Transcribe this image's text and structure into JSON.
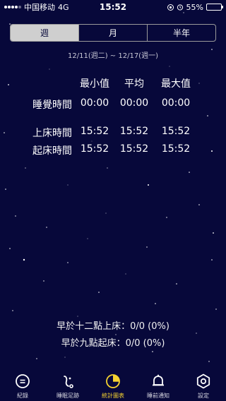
{
  "status_bar": {
    "carrier": "中国移动",
    "network": "4G",
    "time": "15:52",
    "battery_percent": "55%",
    "battery_level": 0.55
  },
  "segments": [
    {
      "label": "週",
      "active": true
    },
    {
      "label": "月",
      "active": false
    },
    {
      "label": "半年",
      "active": false
    }
  ],
  "date_range": "12/11(週二) ~ 12/17(週一)",
  "stats": {
    "headers": [
      "最小值",
      "平均",
      "最大值"
    ],
    "rows": [
      {
        "label": "睡覺時間",
        "values": [
          "00:00",
          "00:00",
          "00:00"
        ]
      },
      {
        "label": "上床時間",
        "values": [
          "15:52",
          "15:52",
          "15:52"
        ]
      },
      {
        "label": "起床時間",
        "values": [
          "15:52",
          "15:52",
          "15:52"
        ]
      }
    ]
  },
  "summary": {
    "before_midnight": "早於十二點上床：0/0 (0%)",
    "before_nine": "早於九點起床：0/0 (0%)"
  },
  "tabbar": [
    {
      "label": "紀錄",
      "icon": "record-icon",
      "active": false
    },
    {
      "label": "睡眠足跡",
      "icon": "footprint-icon",
      "active": false
    },
    {
      "label": "統計圖表",
      "icon": "chart-icon",
      "active": true
    },
    {
      "label": "睡前通知",
      "icon": "bell-icon",
      "active": false
    },
    {
      "label": "設定",
      "icon": "gear-icon",
      "active": false
    }
  ],
  "colors": {
    "background": "#07083a",
    "active_tab": "#f5d230",
    "battery": "#4cd964"
  }
}
